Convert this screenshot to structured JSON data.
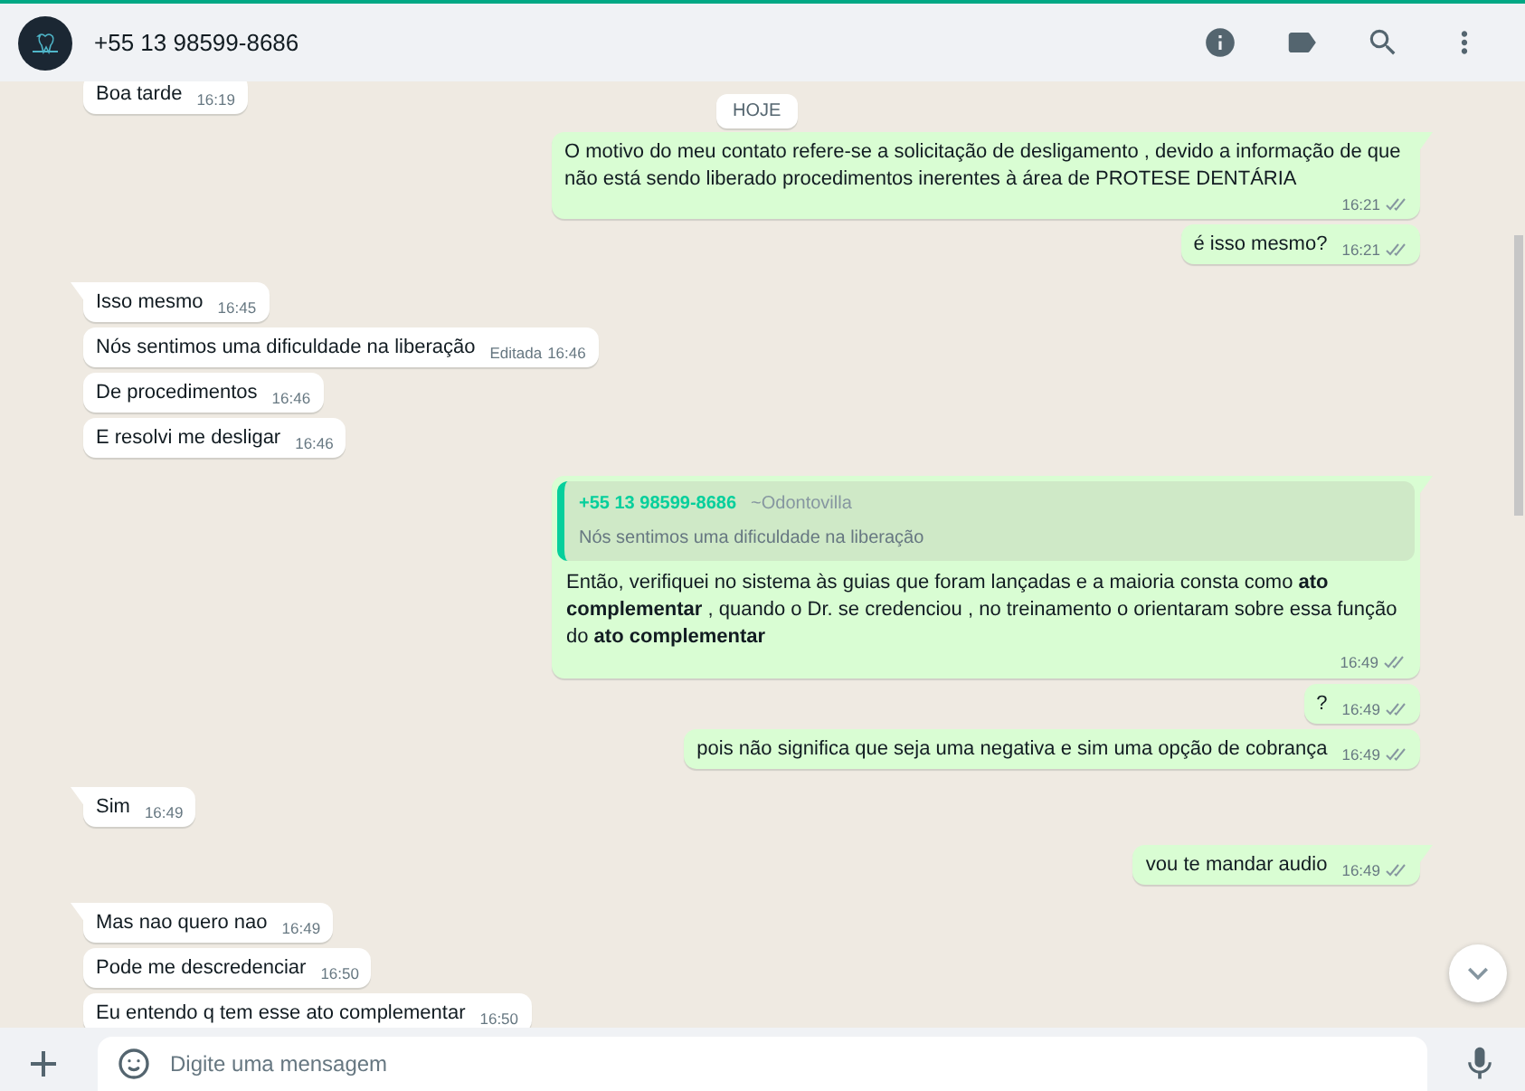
{
  "header": {
    "contact": "+55 13 98599-8686"
  },
  "date_chip": "HOJE",
  "messages": [
    {
      "kind": "in",
      "tail": false,
      "text": "Boa tarde",
      "time": "16:19"
    },
    {
      "kind": "out",
      "tail": true,
      "text": "O motivo do meu contato refere-se a solicitação de desligamento , devido a informação de que não está sendo liberado procedimentos inerentes à área de PROTESE DENTÁRIA",
      "time": "16:21",
      "double_check": true
    },
    {
      "kind": "out",
      "tail": false,
      "text": "é isso mesmo?",
      "time": "16:21",
      "double_check": true
    },
    {
      "kind": "in",
      "tail": true,
      "text": "Isso mesmo",
      "time": "16:45"
    },
    {
      "kind": "in",
      "tail": false,
      "text": "Nós  sentimos uma dificuldade na liberação",
      "edited": "Editada",
      "time": "16:46"
    },
    {
      "kind": "in",
      "tail": false,
      "text": "De procedimentos",
      "time": "16:46"
    },
    {
      "kind": "in",
      "tail": false,
      "text": "E resolvi me desligar",
      "time": "16:46"
    },
    {
      "kind": "out",
      "tail": true,
      "quote": {
        "author": "+55 13 98599-8686",
        "alias": "~Odontovilla",
        "text": "Nós  sentimos uma dificuldade na liberação"
      },
      "text": "Então, verifiquei no sistema às guias que foram lançadas e a maioria consta como **ato complementar** , quando o Dr. se credenciou , no treinamento o orientaram sobre essa função do **ato complementar**",
      "time": "16:49",
      "double_check": true
    },
    {
      "kind": "out",
      "tail": false,
      "text": "?",
      "time": "16:49",
      "double_check": true
    },
    {
      "kind": "out",
      "tail": false,
      "text": "pois não significa que seja uma negativa e sim uma opção de cobrança",
      "time": "16:49",
      "double_check": true
    },
    {
      "kind": "in",
      "tail": true,
      "text": "Sim",
      "time": "16:49"
    },
    {
      "kind": "out",
      "tail": true,
      "text": "vou te mandar audio",
      "time": "16:49",
      "double_check": true
    },
    {
      "kind": "in",
      "tail": true,
      "text": "Mas nao quero nao",
      "time": "16:49"
    },
    {
      "kind": "in",
      "tail": false,
      "text": "Pode me descredenciar",
      "time": "16:50"
    },
    {
      "kind": "in",
      "tail": false,
      "text": "Eu entendo q tem esse ato complementar",
      "time": "16:50"
    }
  ],
  "composer": {
    "placeholder": "Digite uma mensagem"
  }
}
